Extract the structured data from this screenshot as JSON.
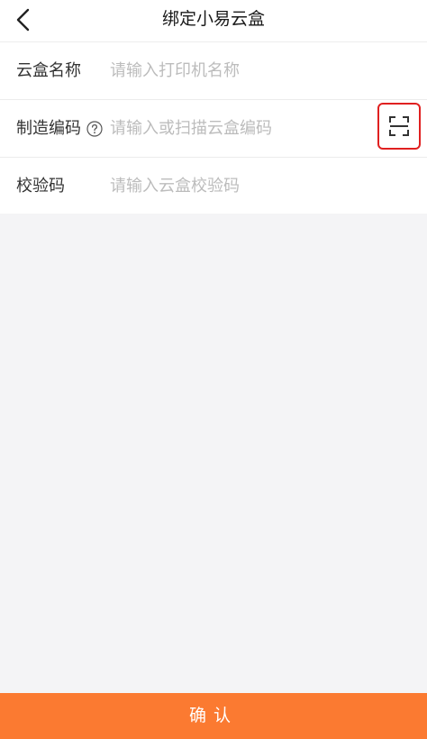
{
  "header": {
    "title": "绑定小易云盒",
    "back_icon": "chevron-left-icon"
  },
  "form": {
    "name": {
      "label": "云盒名称",
      "placeholder": "请输入打印机名称",
      "value": ""
    },
    "serial": {
      "label": "制造编码",
      "placeholder": "请输入或扫描云盒编码",
      "value": "",
      "help_icon": "question-circle-icon",
      "scan_icon": "scan-icon"
    },
    "verify": {
      "label": "校验码",
      "placeholder": "请输入云盒校验码",
      "value": ""
    }
  },
  "footer": {
    "confirm_label": "确认"
  },
  "colors": {
    "accent": "#fb7a31",
    "highlight": "#e02020",
    "background": "#f4f4f6"
  }
}
